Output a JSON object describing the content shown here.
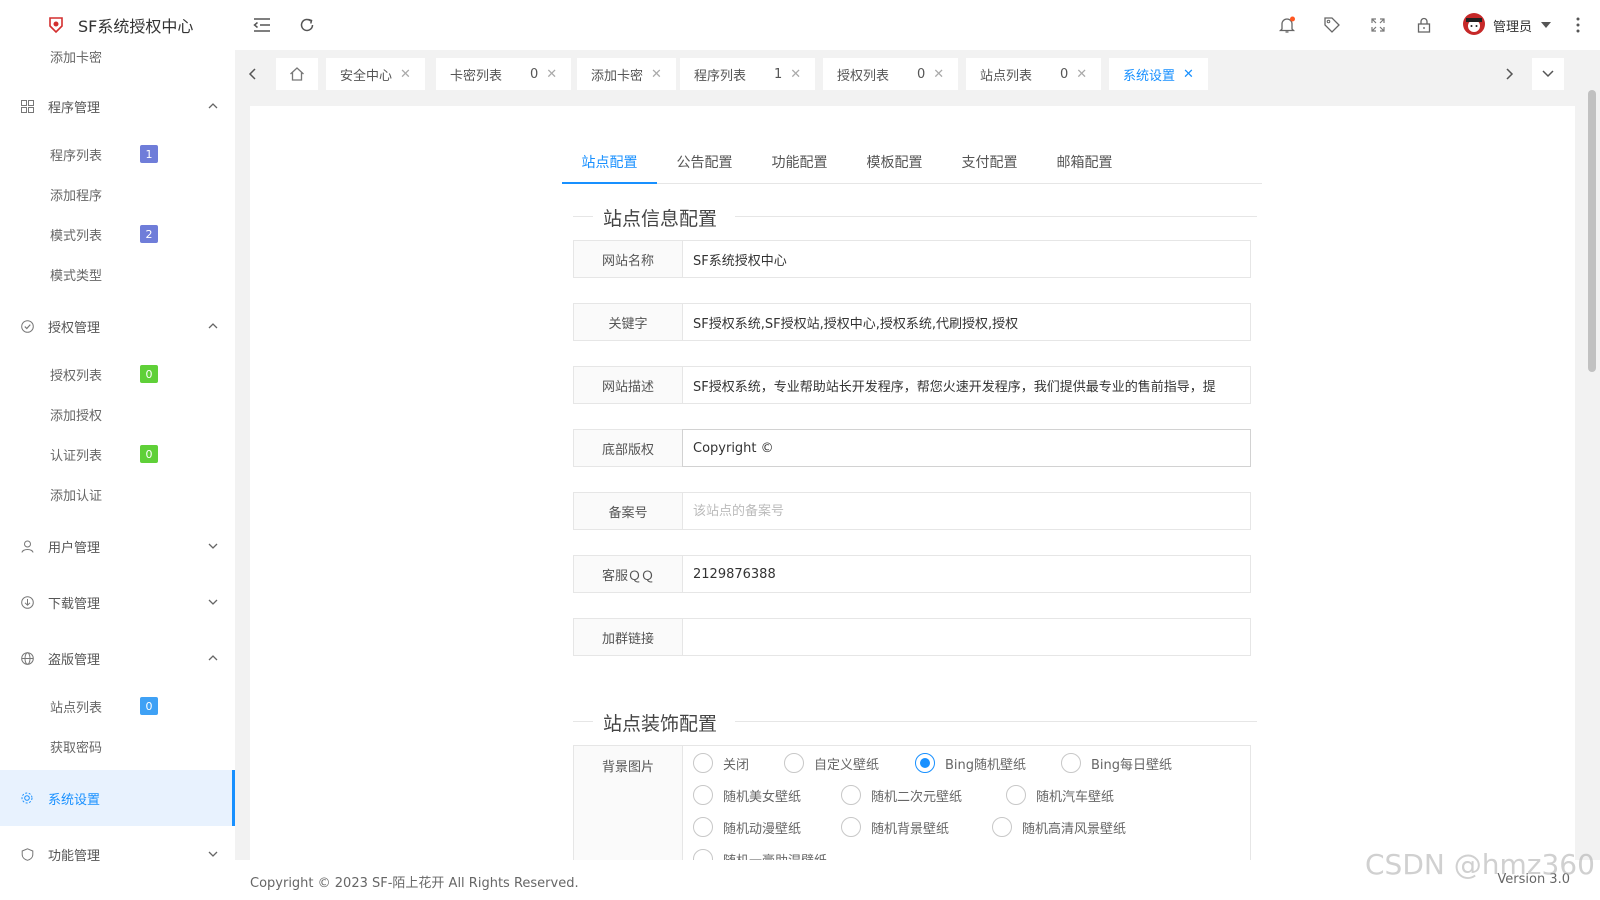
{
  "brand": {
    "title": "SF系统授权中心"
  },
  "sidebar": {
    "top_item": "添加卡密",
    "groups": [
      {
        "label": "程序管理",
        "items": [
          {
            "label": "程序列表",
            "badge": "1"
          },
          {
            "label": "添加程序"
          },
          {
            "label": "模式列表",
            "badge": "2"
          },
          {
            "label": "模式类型"
          }
        ]
      },
      {
        "label": "授权管理",
        "items": [
          {
            "label": "授权列表",
            "badge": "0"
          },
          {
            "label": "添加授权"
          },
          {
            "label": "认证列表",
            "badge": "0"
          },
          {
            "label": "添加认证"
          }
        ]
      },
      {
        "label": "用户管理"
      },
      {
        "label": "下载管理"
      },
      {
        "label": "盗版管理",
        "items": [
          {
            "label": "站点列表",
            "badge": "0"
          },
          {
            "label": "获取密码"
          }
        ]
      },
      {
        "label": "系统设置"
      },
      {
        "label": "功能管理"
      }
    ],
    "colors": {
      "badge_purple": "#6f7dd9",
      "badge_green": "#5fd038",
      "badge_blue": "#3fa1f5",
      "accent": "#1890ff"
    }
  },
  "header": {
    "user_name": "管理员"
  },
  "tabs": [
    {
      "label": "安全中心"
    },
    {
      "label": "卡密列表",
      "count": "0"
    },
    {
      "label": "添加卡密"
    },
    {
      "label": "程序列表",
      "count": "1"
    },
    {
      "label": "授权列表",
      "count": "0"
    },
    {
      "label": "站点列表",
      "count": "0"
    },
    {
      "label": "系统设置"
    }
  ],
  "content_tabs": [
    "站点配置",
    "公告配置",
    "功能配置",
    "模板配置",
    "支付配置",
    "邮箱配置"
  ],
  "section1": {
    "title": "站点信息配置",
    "fields": [
      {
        "label": "网站名称",
        "value": "SF系统授权中心"
      },
      {
        "label": "关键字",
        "value": "SF授权系统,SF授权站,授权中心,授权系统,代刷授权,授权"
      },
      {
        "label": "网站描述",
        "value": "SF授权系统，专业帮助站长开发程序，帮您火速开发程序，我们提供最专业的售前指导，提"
      },
      {
        "label": "底部版权",
        "value": "Copyright ©"
      },
      {
        "label": "备案号",
        "value": "",
        "placeholder": "该站点的备案号"
      },
      {
        "label": "客服ＱＱ",
        "value": "2129876388"
      },
      {
        "label": "加群链接",
        "value": ""
      }
    ]
  },
  "section2": {
    "title": "站点装饰配置",
    "bg_label": "背景图片",
    "options": [
      "关闭",
      "自定义壁纸",
      "Bing随机壁纸",
      "Bing每日壁纸",
      "随机美女壁纸",
      "随机二次元壁纸",
      "随机汽车壁纸",
      "随机动漫壁纸",
      "随机背景壁纸",
      "随机高清风景壁纸",
      "随机一膏助湿壁纸"
    ],
    "selected": "Bing随机壁纸"
  },
  "footer": {
    "copyright": "Copyright © 2023 SF-陌上花开 All Rights Reserved.",
    "version": "Version 3.0"
  },
  "watermark": "CSDN @hmz360"
}
